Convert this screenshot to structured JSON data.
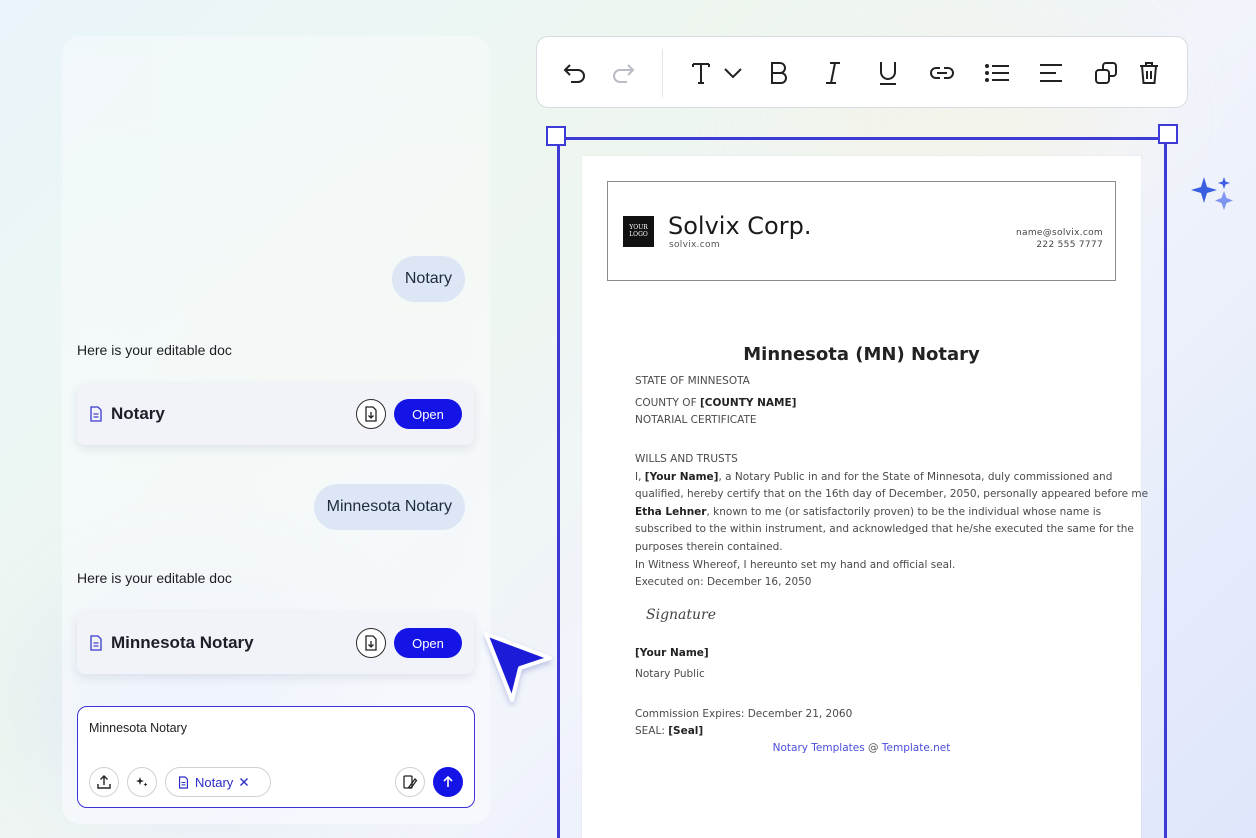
{
  "chat": {
    "messages": [
      {
        "role": "user",
        "text": "Notary"
      },
      {
        "role": "assistant",
        "text": "Here is your editable doc"
      },
      {
        "role": "user",
        "text": "Minnesota Notary"
      },
      {
        "role": "assistant",
        "text": "Here is your editable doc"
      }
    ],
    "doc_cards": [
      {
        "name": "Notary",
        "open_label": "Open"
      },
      {
        "name": "Minnesota Notary",
        "open_label": "Open"
      }
    ],
    "composer": {
      "text": "Minnesota Notary",
      "chip_label": "Notary"
    }
  },
  "toolbar": {
    "tools": [
      "undo-icon",
      "redo-icon",
      "text-style-icon",
      "chevron-down-icon",
      "bold-icon",
      "italic-icon",
      "underline-icon",
      "link-icon",
      "bulleted-list-icon",
      "align-left-icon",
      "duplicate-icon",
      "delete-icon"
    ]
  },
  "document": {
    "letterhead": {
      "logo_text_1": "YOUR",
      "logo_text_2": "LOGO",
      "company": "Solvix Corp.",
      "website": "solvix.com",
      "email": "name@solvix.com",
      "phone": "222 555 7777"
    },
    "title": "Minnesota (MN) Notary",
    "state": "STATE OF MINNESOTA",
    "county_prefix": "COUNTY OF ",
    "county_value": "[COUNTY NAME]",
    "certificate": "NOTARIAL CERTIFICATE",
    "section": "WILLS AND TRUSTS",
    "body": {
      "l1_pre": "I, ",
      "l1_name": "[Your Name]",
      "l1_post": ", a Notary Public in and for the State of Minnesota, duly commissioned and",
      "l2": "qualified, hereby certify that on the 16th day of December, 2050, personally appeared before me",
      "l3_name": "Etha Lehner",
      "l3_post": ", known to me (or satisfactorily proven) to be the individual whose name is",
      "l4": "subscribed to the within instrument, and acknowledged that he/she executed the same for the",
      "l5": "purposes therein contained.",
      "l6": "In Witness Whereof, I hereunto set my hand and official seal.",
      "l7": "Executed on: December 16, 2050"
    },
    "signature": "Signature",
    "signer_name": "[Your Name]",
    "signer_title": "Notary Public",
    "commission": "Commission Expires: December 21, 2060",
    "seal_label": "SEAL: ",
    "seal_value": "[Seal]",
    "footer_link_1": "Notary Templates",
    "footer_sep": " @ ",
    "footer_link_2": "Template.net"
  },
  "colors": {
    "accent": "#1414e6",
    "selection": "#3d3ad6",
    "link": "#4b4ddb",
    "bubble": "#dce6f4"
  }
}
